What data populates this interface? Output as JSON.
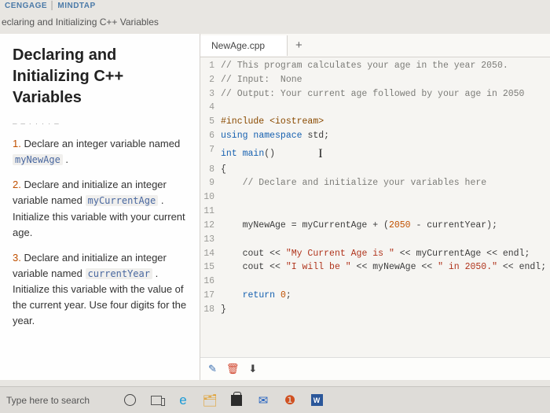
{
  "brand": {
    "left": "CENGAGE",
    "right": "MINDTAP"
  },
  "subheader": "eclaring and Initializing C++ Variables",
  "lesson_title": "Declaring and Initializing C++ Variables",
  "steps": [
    {
      "num": "1.",
      "before": "Declare an integer variable named ",
      "code": "myNewAge",
      "after": " ."
    },
    {
      "num": "2.",
      "before": "Declare and initialize an integer variable named ",
      "code": "myCurrentAge",
      "after": " . Initialize this variable with your current age."
    },
    {
      "num": "3.",
      "before": "Declare and initialize an integer variable named ",
      "code": "currentYear",
      "after": " . Initialize this variable with the value of the current year. Use four digits for the year."
    }
  ],
  "tab_name": "NewAge.cpp",
  "tab_plus": "+",
  "code_lines": [
    {
      "n": "1",
      "type": "cm",
      "t": "// This program calculates your age in the year 2050."
    },
    {
      "n": "2",
      "type": "cm",
      "t": "// Input:  None"
    },
    {
      "n": "3",
      "type": "cm",
      "t": "// Output: Your current age followed by your age in 2050"
    },
    {
      "n": "4",
      "type": "blank",
      "t": ""
    },
    {
      "n": "5",
      "type": "pp",
      "t": "#include <iostream>"
    },
    {
      "n": "6",
      "type": "using",
      "kw1": "using",
      "kw2": "namespace",
      "id": "std",
      "tail": ";"
    },
    {
      "n": "7",
      "type": "main",
      "ty": "int",
      "id": "main",
      "tail": "()",
      "cursor": true
    },
    {
      "n": "8",
      "type": "plain",
      "t": "{"
    },
    {
      "n": "9",
      "type": "cm",
      "t": "    // Declare and initialize your variables here"
    },
    {
      "n": "10",
      "type": "blank",
      "t": ""
    },
    {
      "n": "11",
      "type": "blank",
      "t": ""
    },
    {
      "n": "12",
      "type": "expr",
      "pre": "    myNewAge = myCurrentAge + (",
      "num": "2050",
      "post": " - currentYear);"
    },
    {
      "n": "13",
      "type": "blank",
      "t": ""
    },
    {
      "n": "14",
      "type": "cout",
      "pre": "    cout << ",
      "str": "\"My Current Age is \"",
      "post": " << myCurrentAge << endl;"
    },
    {
      "n": "15",
      "type": "cout2",
      "pre": "    cout << ",
      "str1": "\"I will be \"",
      "mid": " << myNewAge << ",
      "str2": "\" in 2050.\"",
      "post": " << endl;"
    },
    {
      "n": "16",
      "type": "blank",
      "t": ""
    },
    {
      "n": "17",
      "type": "ret",
      "pre": "    ",
      "kw": "return",
      "sp": " ",
      "num": "0",
      "post": ";"
    },
    {
      "n": "18",
      "type": "plain",
      "t": "}"
    }
  ],
  "toolbar": {
    "pencil": "✎",
    "trash": "🗑",
    "download": "⬇"
  },
  "taskbar": {
    "search": "Type here to search",
    "word_letter": "W"
  }
}
